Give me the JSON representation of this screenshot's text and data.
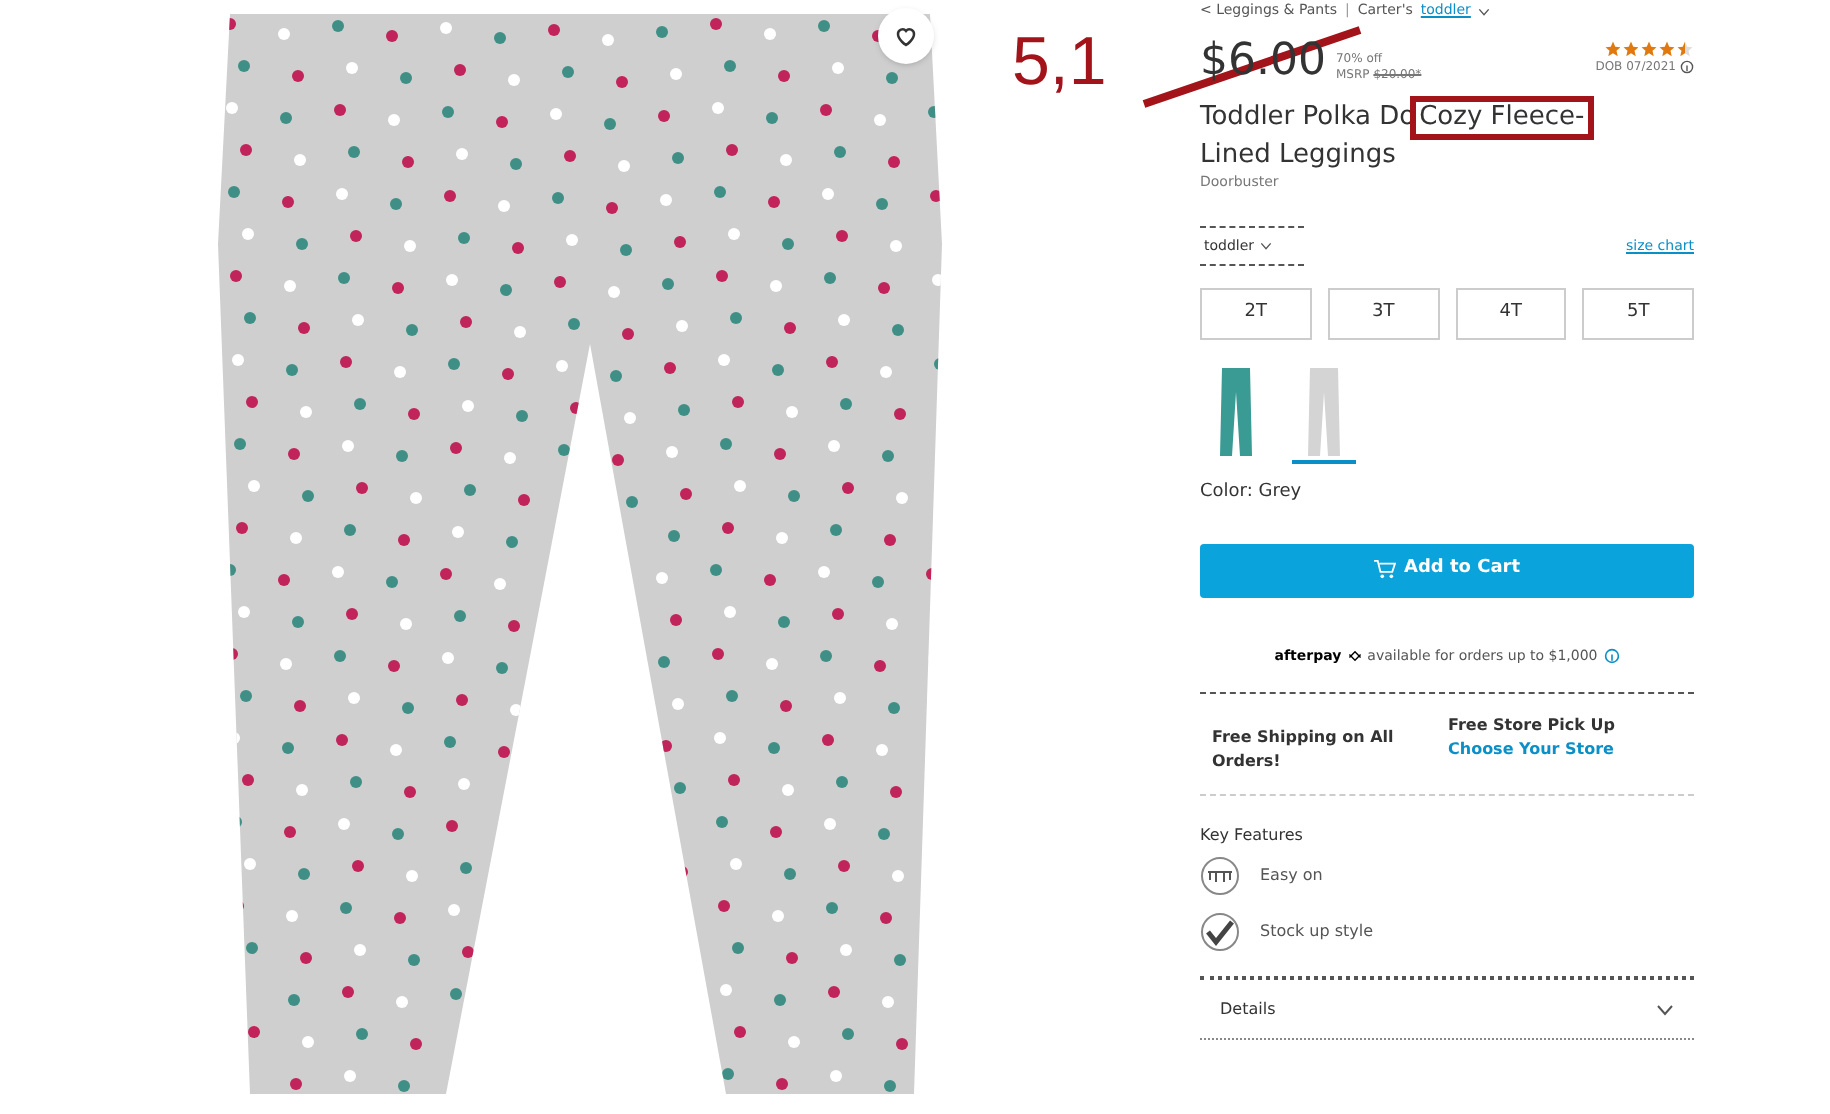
{
  "breadcrumb": {
    "category": "< Leggings & Pants",
    "separator": "|",
    "brand": "Carter's",
    "size_link": "toddler"
  },
  "annotation": {
    "text": "5,1"
  },
  "price": {
    "amount": "$6.00",
    "discount": "70% off",
    "msrp_label": "MSRP",
    "msrp": "$20.00*"
  },
  "rating": {
    "stars": 4.5,
    "note": "DOB 07/2021"
  },
  "title": {
    "start": "Toddler Polka Do",
    "highlighted": "Cozy Fleece-",
    "end": "Lined Leggings"
  },
  "badge": "Doorbuster",
  "size_type": "toddler",
  "size_chart": "size chart",
  "sizes": [
    "2T",
    "3T",
    "4T",
    "5T"
  ],
  "swatches": [
    {
      "color": "#3a9a94",
      "selected": false
    },
    {
      "color": "#d4d4d4",
      "selected": true
    }
  ],
  "color_label": "Color: Grey",
  "add_to_cart": "Add to Cart",
  "afterpay": {
    "brand": "afterpay",
    "text": "available for orders up to $1,000"
  },
  "shipping": {
    "free_shipping": "Free Shipping on All Orders!",
    "pickup_title": "Free Store Pick Up",
    "pickup_link": "Choose Your Store"
  },
  "key_features": {
    "title": "Key Features",
    "items": [
      {
        "kind": "easy",
        "label": "Easy on"
      },
      {
        "kind": "check",
        "label": "Stock up style"
      }
    ]
  },
  "details": "Details"
}
